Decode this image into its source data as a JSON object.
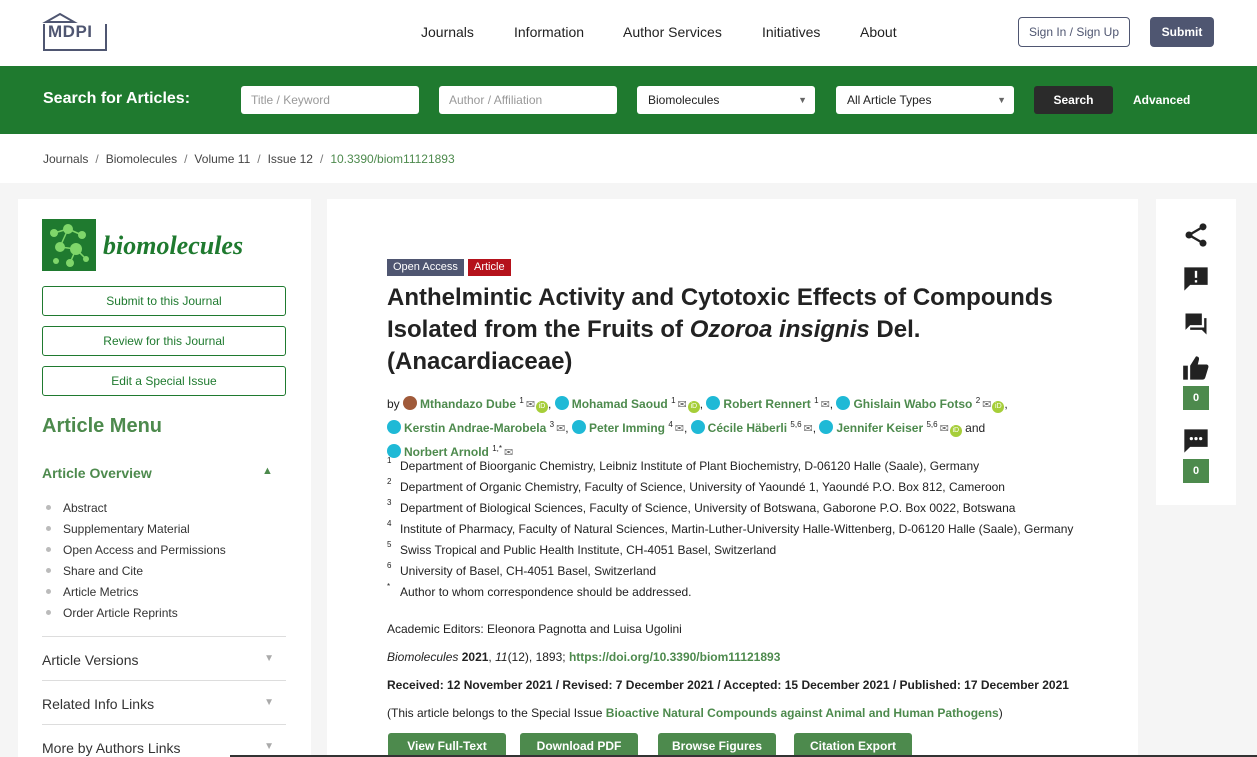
{
  "header": {
    "logo_text": "MDPI",
    "nav": [
      "Journals",
      "Information",
      "Author Services",
      "Initiatives",
      "About"
    ],
    "sign_in_label": "Sign In / Sign Up",
    "submit_label": "Submit"
  },
  "search": {
    "title": "Search for Articles:",
    "keyword_placeholder": "Title / Keyword",
    "author_placeholder": "Author / Affiliation",
    "journal_selected": "Biomolecules",
    "type_selected": "All Article Types",
    "search_label": "Search",
    "advanced_label": "Advanced"
  },
  "breadcrumb": [
    "Journals",
    "Biomolecules",
    "Volume 11",
    "Issue 12",
    "10.3390/biom11121893"
  ],
  "sidebar": {
    "journal_name": "biomolecules",
    "buttons": [
      "Submit to this Journal",
      "Review for this Journal",
      "Edit a Special Issue"
    ],
    "menu_title": "Article Menu",
    "overview_title": "Article Overview",
    "overview_items": [
      "Abstract",
      "Supplementary Material",
      "Open Access and Permissions",
      "Share and Cite",
      "Article Metrics",
      "Order Article Reprints"
    ],
    "sections": [
      "Article Versions",
      "Related Info Links",
      "More by Authors Links"
    ]
  },
  "article": {
    "badge_open_access": "Open Access",
    "badge_article": "Article",
    "badge_colors": {
      "open_access": "#4f5671",
      "article": "#b5121b"
    },
    "title_part1": "Anthelmintic Activity and Cytotoxic Effects of Compounds Isolated from the Fruits of ",
    "title_italic": "Ozoroa insignis",
    "title_part2": " Del. (Anacardiaceae)",
    "by_label": "by",
    "and_label": "and",
    "authors": [
      {
        "name": "Mthandazo Dube",
        "sup": "1"
      },
      {
        "name": "Mohamad Saoud",
        "sup": "1"
      },
      {
        "name": "Robert Rennert",
        "sup": "1"
      },
      {
        "name": "Ghislain Wabo Fotso",
        "sup": "2"
      },
      {
        "name": "Kerstin Andrae-Marobela",
        "sup": "3"
      },
      {
        "name": "Peter Imming",
        "sup": "4"
      },
      {
        "name": "Cécile Häberli",
        "sup": "5,6"
      },
      {
        "name": "Jennifer Keiser",
        "sup": "5,6"
      },
      {
        "name": "Norbert Arnold",
        "sup": "1,*"
      }
    ],
    "affiliations": [
      {
        "num": "1",
        "text": "Department of Bioorganic Chemistry, Leibniz Institute of Plant Biochemistry, D-06120 Halle (Saale), Germany"
      },
      {
        "num": "2",
        "text": "Department of Organic Chemistry, Faculty of Science, University of Yaoundé 1, Yaoundé P.O. Box 812, Cameroon"
      },
      {
        "num": "3",
        "text": "Department of Biological Sciences, Faculty of Science, University of Botswana, Gaborone P.O. Box 0022, Botswana"
      },
      {
        "num": "4",
        "text": "Institute of Pharmacy, Faculty of Natural Sciences, Martin-Luther-University Halle-Wittenberg, D-06120 Halle (Saale), Germany"
      },
      {
        "num": "5",
        "text": "Swiss Tropical and Public Health Institute, CH-4051 Basel, Switzerland"
      },
      {
        "num": "6",
        "text": "University of Basel, CH-4051 Basel, Switzerland"
      },
      {
        "num": "*",
        "text": "Author to whom correspondence should be addressed."
      }
    ],
    "editors": "Academic Editors: Eleonora Pagnotta and Luisa Ugolini",
    "citation_journal": "Biomolecules",
    "citation_year": "2021",
    "citation_volume": "11",
    "citation_rest": "(12), 1893; ",
    "citation_doi": "https://doi.org/10.3390/biom11121893",
    "dates": "Received: 12 November 2021 / Revised: 7 December 2021 / Accepted: 15 December 2021 / Published: 17 December 2021",
    "special_prefix": "(This article belongs to the Special Issue ",
    "special_link": "Bioactive Natural Compounds against Animal and Human Pathogens",
    "special_suffix": ")",
    "actions": [
      "View Full-Text",
      "Download PDF",
      "Browse Figures",
      "Citation Export"
    ]
  },
  "right_panel": {
    "icons": [
      "share-icon",
      "report-icon",
      "comment-icon",
      "like-icon",
      "discussion-icon"
    ],
    "like_count": "0",
    "discussion_count": "0"
  },
  "colors": {
    "brand": "#4f5671",
    "green": "#1f7a2f",
    "link_green": "#4d8a4d"
  }
}
